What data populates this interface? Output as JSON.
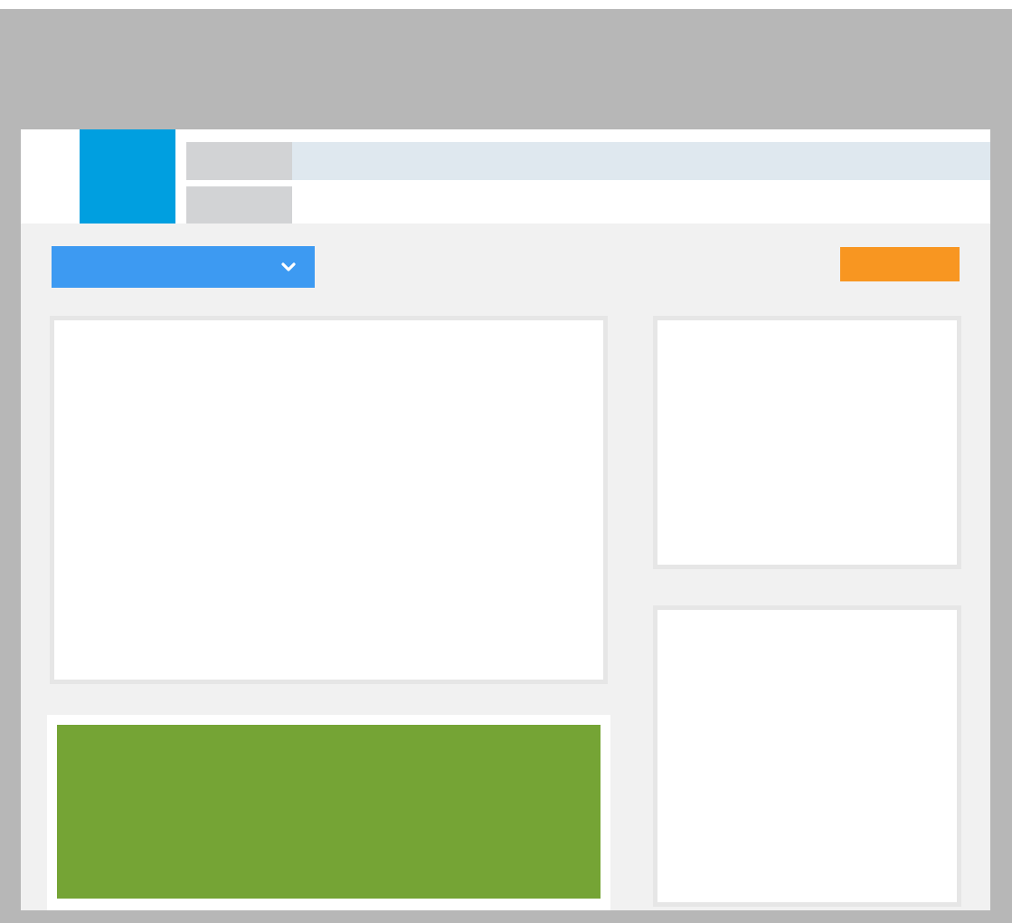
{
  "colors": {
    "frame": "#b7b7b7",
    "page_background": "#f1f1f1",
    "header_background": "#ffffff",
    "logo": "#009fe0",
    "nav_strip": "#dfe8ef",
    "nav_tab": "#d2d3d5",
    "dropdown": "#3d9af2",
    "dropdown_chevron": "#ffffff",
    "action_button": "#f89621",
    "panel_background": "#ffffff",
    "panel_border": "#e6e6e6",
    "banner": "#75a435"
  },
  "header": {
    "logo_icon": "logo-block",
    "nav_tabs": [
      {
        "label": ""
      },
      {
        "label": ""
      }
    ]
  },
  "toolbar": {
    "dropdown": {
      "selected": "",
      "icon": "chevron-down-icon"
    },
    "action_button_label": ""
  },
  "panels": {
    "main": {
      "content": ""
    },
    "right_top": {
      "content": ""
    },
    "right_bottom": {
      "content": ""
    }
  },
  "banner": {
    "text": ""
  }
}
